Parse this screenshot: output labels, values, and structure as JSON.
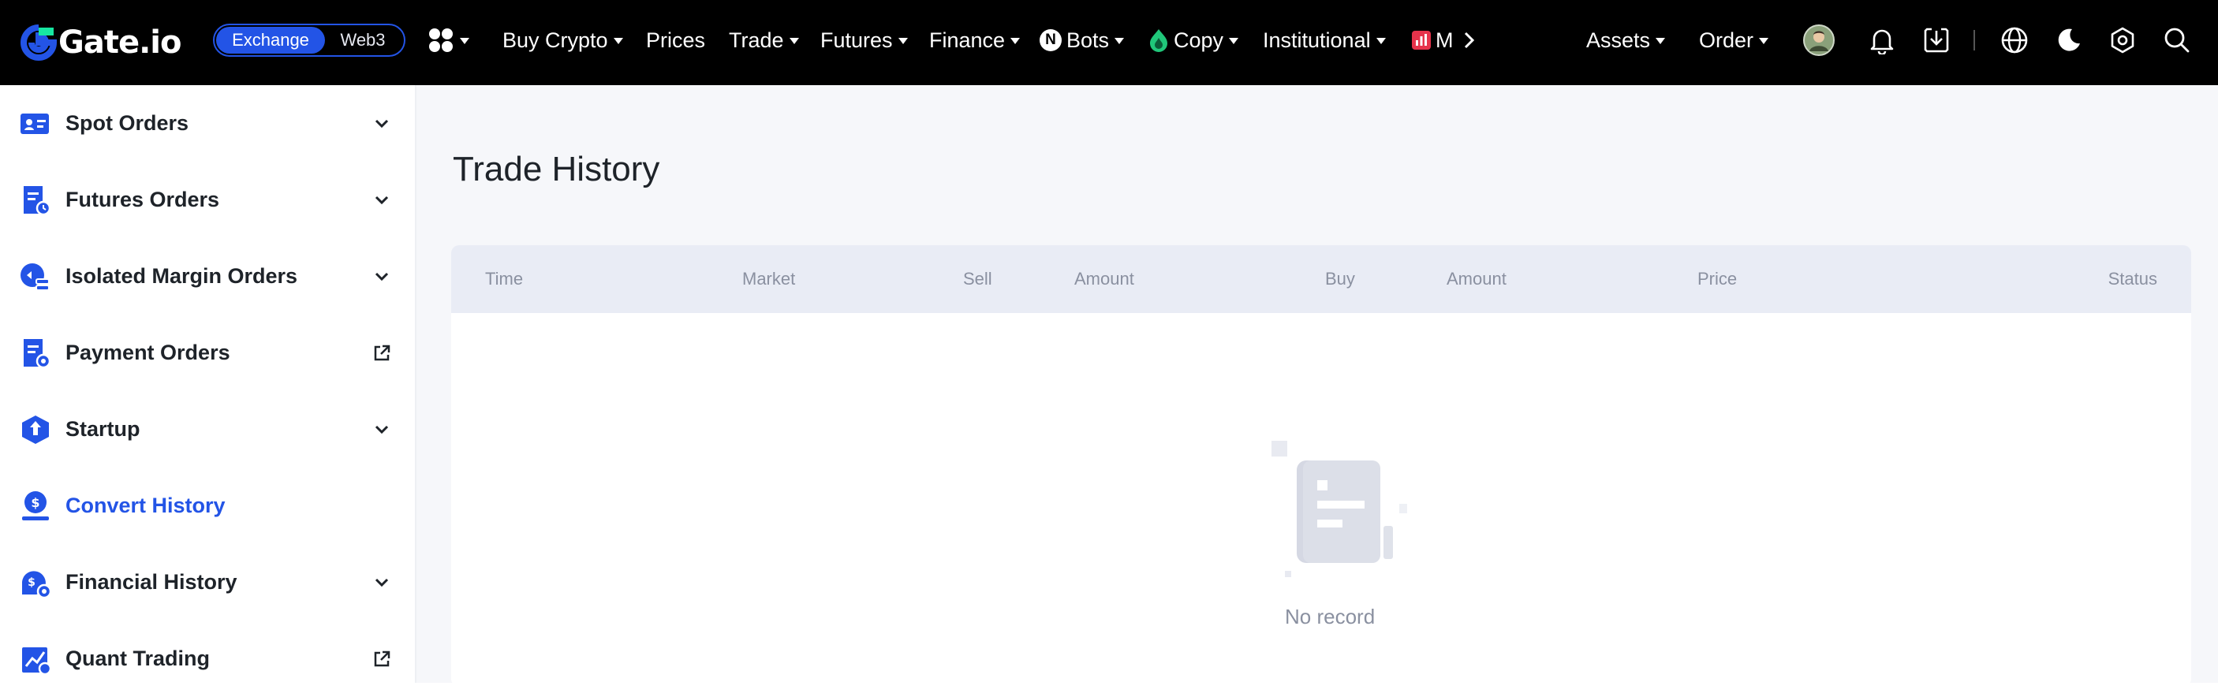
{
  "brand": {
    "name": "Gate.io",
    "accent": "#2354e6",
    "topbar_bg": "#000000"
  },
  "mode_switch": {
    "active": "Exchange",
    "inactive": "Web3"
  },
  "nav": {
    "apps_icon": "apps-grid-icon",
    "items": [
      {
        "label": "Buy Crypto",
        "dropdown": true
      },
      {
        "label": "Prices",
        "dropdown": false
      },
      {
        "label": "Trade",
        "dropdown": true
      },
      {
        "label": "Futures",
        "dropdown": true
      },
      {
        "label": "Finance",
        "dropdown": true
      },
      {
        "label": "Bots",
        "dropdown": true,
        "icon": "bots-icon"
      },
      {
        "label": "Copy",
        "dropdown": true,
        "icon": "copy-flame-icon"
      },
      {
        "label": "Institutional",
        "dropdown": true
      },
      {
        "label": "M",
        "dropdown": false,
        "icon": "market-icon"
      }
    ],
    "more_icon": "chevron-right-icon"
  },
  "right_nav": {
    "assets": "Assets",
    "order": "Order",
    "icons": [
      "avatar",
      "bell-icon",
      "download-icon",
      "globe-icon",
      "moon-icon",
      "settings-icon",
      "search-icon"
    ]
  },
  "sidebar": {
    "items": [
      {
        "label": "Spot Orders",
        "icon": "spot-orders-icon",
        "right": "chevron-down-icon",
        "active": false
      },
      {
        "label": "Futures Orders",
        "icon": "futures-orders-icon",
        "right": "chevron-down-icon",
        "active": false
      },
      {
        "label": "Isolated Margin Orders",
        "icon": "margin-orders-icon",
        "right": "chevron-down-icon",
        "active": false
      },
      {
        "label": "Payment Orders",
        "icon": "payment-orders-icon",
        "right": "external-link-icon",
        "active": false
      },
      {
        "label": "Startup",
        "icon": "startup-icon",
        "right": "chevron-down-icon",
        "active": false
      },
      {
        "label": "Convert History",
        "icon": "convert-history-icon",
        "right": "",
        "active": true
      },
      {
        "label": "Financial History",
        "icon": "financial-history-icon",
        "right": "chevron-down-icon",
        "active": false
      },
      {
        "label": "Quant Trading",
        "icon": "quant-trading-icon",
        "right": "external-link-icon",
        "active": false
      }
    ]
  },
  "main": {
    "title": "Trade History",
    "table": {
      "columns": [
        "Time",
        "Market",
        "Sell",
        "Amount",
        "Buy",
        "Amount",
        "Price",
        "Status"
      ],
      "rows": []
    },
    "empty": {
      "icon": "empty-document-icon",
      "text": "No record"
    }
  }
}
